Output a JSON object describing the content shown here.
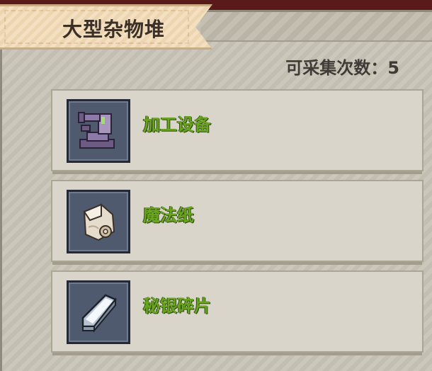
{
  "header": {
    "title": "大型杂物堆",
    "collect_count_label": "可采集次数：5"
  },
  "items": [
    {
      "name": "加工设备",
      "icon": "crafting-machine-icon"
    },
    {
      "name": "魔法纸",
      "icon": "magic-scroll-icon"
    },
    {
      "name": "秘银碎片",
      "icon": "mithril-shard-icon"
    }
  ],
  "colors": {
    "item_name": "#6aa51f",
    "icon_background": "#4f5a6e",
    "banner": "#f3dcb7",
    "panel": "#c9c5b8"
  }
}
